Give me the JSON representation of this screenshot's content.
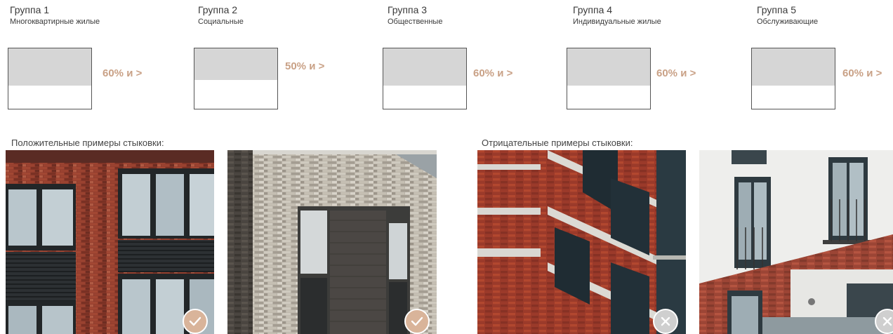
{
  "groups": [
    {
      "title": "Группа 1",
      "subtitle": "Многоквартирные жилые",
      "percent": "60% и >",
      "fill": 0.62
    },
    {
      "title": "Группа 2",
      "subtitle": "Социальные",
      "percent": "50% и >",
      "fill": 0.52
    },
    {
      "title": "Группа 3",
      "subtitle": "Общественные",
      "percent": "60% и >",
      "fill": 0.62
    },
    {
      "title": "Группа 4",
      "subtitle": "Индивидуальные жилые",
      "percent": "60% и >",
      "fill": 0.62
    },
    {
      "title": "Группа 5",
      "subtitle": "Обслуживающие",
      "percent": "60% и >",
      "fill": 0.62
    }
  ],
  "positive": {
    "label": "Положительные примеры стыковки:",
    "badge_icon": "check-icon"
  },
  "negative": {
    "label": "Отрицательные примеры стыковки:",
    "badge_icon": "cross-icon"
  },
  "colors": {
    "accent": "#c9a186",
    "diagram_fill": "#d6d6d6",
    "positive_badge": "#d9b49a",
    "negative_badge": "#cfcfcf"
  }
}
